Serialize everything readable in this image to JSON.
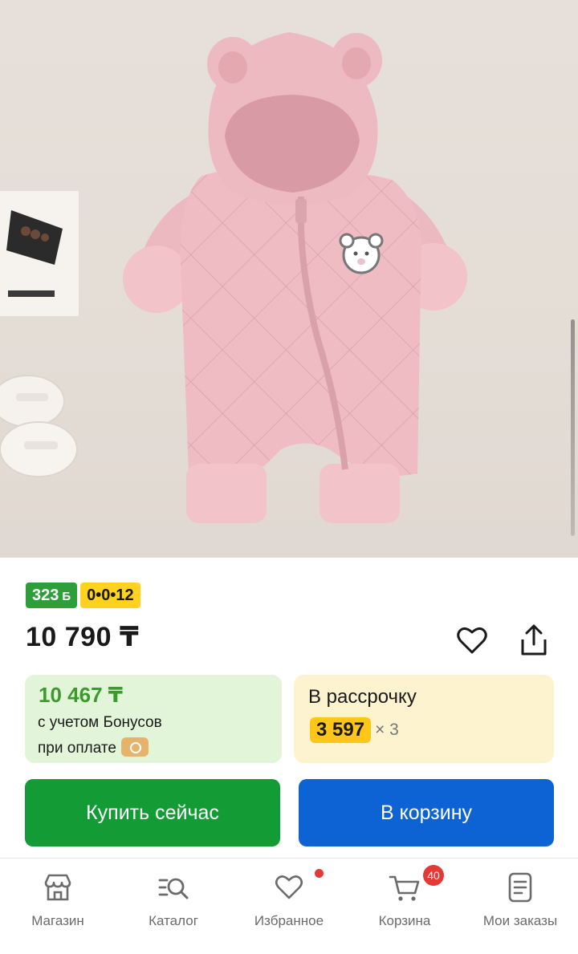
{
  "product": {
    "image_alt": "pink quilted baby jumpsuit with bear ears"
  },
  "badges": {
    "bonus_value": "323",
    "bonus_unit": "Б",
    "installment_code": "0•0•12"
  },
  "price": {
    "current": "10 790 ₸"
  },
  "actions_icons": {
    "favorite": "heart-icon",
    "share": "share-icon"
  },
  "bonus_card": {
    "price": "10 467 ₸",
    "line1": "с учетом Бонусов",
    "line2": "при оплате"
  },
  "installment_card": {
    "label": "В рассрочку",
    "amount": "3 597",
    "multiplier": "× 3"
  },
  "buttons": {
    "buy_now": "Купить сейчас",
    "add_to_cart": "В корзину"
  },
  "bottom_nav": {
    "items": [
      {
        "label": "Магазин",
        "icon": "store-icon"
      },
      {
        "label": "Каталог",
        "icon": "catalog-search-icon"
      },
      {
        "label": "Избранное",
        "icon": "heart-icon"
      },
      {
        "label": "Корзина",
        "icon": "cart-icon",
        "badge": "40"
      },
      {
        "label": "Мои заказы",
        "icon": "orders-icon"
      }
    ]
  },
  "colors": {
    "accent_green": "#139c35",
    "accent_blue": "#0d63d4",
    "bonus_green": "#2e9e3a",
    "installment_yellow": "#ffd21f",
    "notification_red": "#e53935"
  }
}
